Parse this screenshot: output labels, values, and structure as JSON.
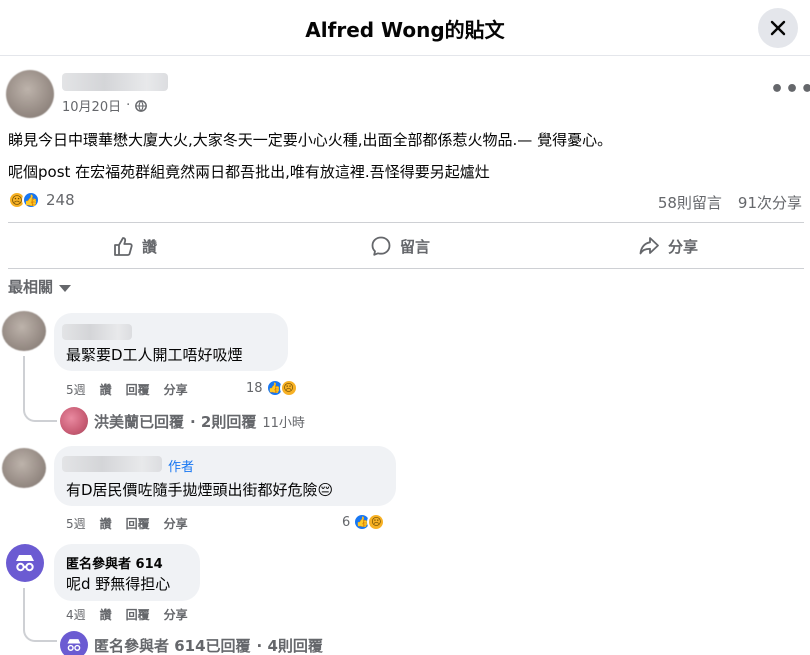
{
  "header": {
    "title": "Alfred Wong的貼文",
    "close_icon": "close-icon"
  },
  "post": {
    "date": "10月20日",
    "separator": "·",
    "visibility_icon": "globe-icon",
    "more_label": "•••",
    "text_line1": "睇見今日中環華懋大廈大火,大家冬天一定要小心火種,出面全部都係惹火物品.— 覺得憂心。",
    "text_line2": "呢個post 在宏福苑群組竟然兩日都吾批出,唯有放這裡.吾怪得要另起爐灶",
    "reaction_count": "248",
    "comments_count": "58則留言",
    "shares_count": "91次分享"
  },
  "actions": {
    "like": "讚",
    "comment": "留言",
    "share": "分享"
  },
  "sort_label": "最相關",
  "comments": [
    {
      "text": "最緊要D工人開工唔好吸煙",
      "age": "5週",
      "like": "讚",
      "reply": "回覆",
      "share": "分享",
      "reaction_count": "18",
      "reply_summary": {
        "name": "洪美蘭已回覆",
        "count": "· 2則回覆",
        "time": "11小時"
      }
    },
    {
      "author_tag": "作者",
      "text": "有D居民價咗隨手拋煙頭出街都好危險😔",
      "age": "5週",
      "like": "讚",
      "reply": "回覆",
      "share": "分享",
      "reaction_count": "6"
    },
    {
      "name": "匿名參與者 614",
      "text": "呢d 野無得担心",
      "age": "4週",
      "like": "讚",
      "reply": "回覆",
      "share": "分享",
      "reply_summary": {
        "name": "匿名參與者 614已回覆",
        "count": "· 4則回覆"
      }
    }
  ],
  "colors": {
    "accent": "#1877f2",
    "secondary_text": "#65676b",
    "bubble": "#f0f2f5",
    "anon_avatar": "#6b5bd2"
  }
}
